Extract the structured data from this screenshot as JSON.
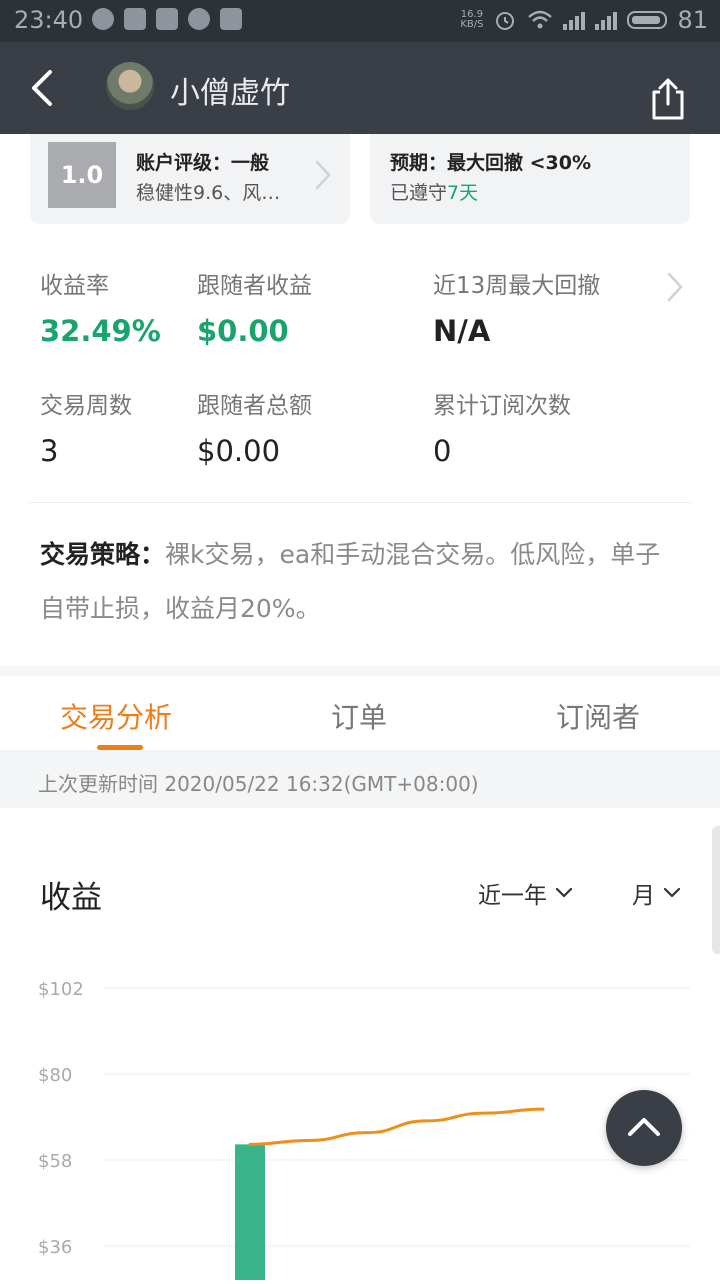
{
  "status_bar": {
    "time": "23:40",
    "net_speed_value": "16.9",
    "net_speed_unit": "KB/S",
    "network_type": "4G",
    "battery_level": "81"
  },
  "header": {
    "title": "小僧虚竹",
    "back_icon": "chevron-left-icon",
    "share_icon": "share-icon"
  },
  "rating_card": {
    "score": "1.0",
    "title": "账户评级：一般",
    "subtitle": "稳健性9.6、风…"
  },
  "expectation_card": {
    "title": "预期：最大回撤 <30%",
    "followed_prefix": "已遵守",
    "followed_value": "7天"
  },
  "stats": {
    "return_rate": {
      "label": "收益率",
      "value": "32.49%"
    },
    "follower_profit": {
      "label": "跟随者收益",
      "value": "$0.00"
    },
    "max_drawdown_13w": {
      "label": "近13周最大回撤",
      "value": "N/A"
    },
    "trade_weeks": {
      "label": "交易周数",
      "value": "3"
    },
    "follower_total": {
      "label": "跟随者总额",
      "value": "$0.00"
    },
    "subscriptions": {
      "label": "累计订阅次数",
      "value": "0"
    }
  },
  "strategy": {
    "label": "交易策略：",
    "text": "裸k交易，ea和手动混合交易。低风险，单子自带止损，收益月20%。"
  },
  "tabs": [
    {
      "label": "交易分析",
      "active": true
    },
    {
      "label": "订单",
      "active": false
    },
    {
      "label": "订阅者",
      "active": false
    }
  ],
  "update": {
    "text": "上次更新时间 2020/05/22 16:32(GMT+08:00)"
  },
  "chart_section": {
    "title": "收益",
    "period_dropdown": "近一年",
    "granularity_dropdown": "月"
  },
  "chart_data": {
    "type": "bar",
    "title": "收益",
    "y_tick_labels": [
      "$102",
      "$80",
      "$58",
      "$36"
    ],
    "y_ticks": [
      102,
      80,
      58,
      36
    ],
    "ylim": [
      30,
      102
    ],
    "bars": [
      {
        "x": 0,
        "value": 62
      }
    ],
    "line": {
      "x": [
        0,
        1,
        2,
        3,
        4,
        5
      ],
      "y": [
        62,
        63,
        65,
        68,
        70,
        71
      ]
    },
    "colors": {
      "bar": "#39b48a",
      "line": "#ef8f17",
      "grid": "#ececec"
    },
    "grid": true
  },
  "fab": {
    "icon": "chevron-up-icon"
  }
}
